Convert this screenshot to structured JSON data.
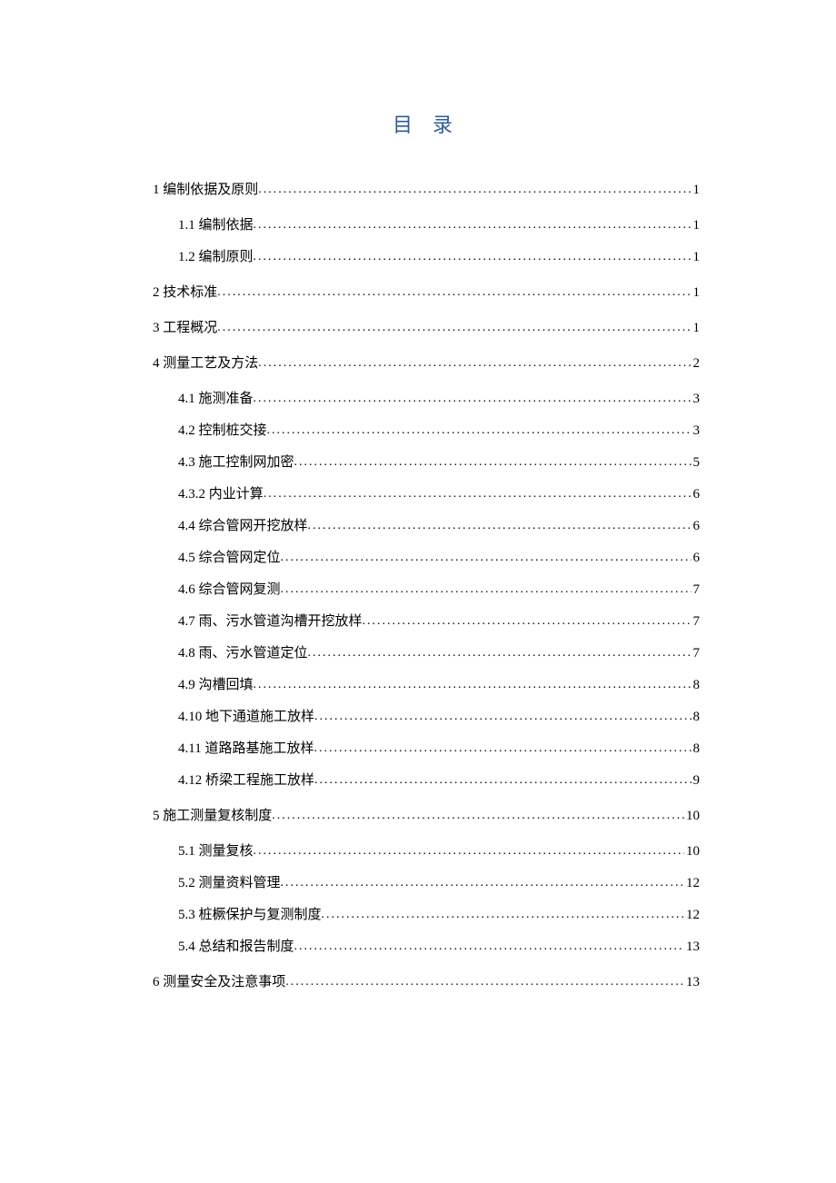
{
  "title": "目 录",
  "entries": [
    {
      "level": 1,
      "label": "1 编制依据及原则",
      "page": "1"
    },
    {
      "level": 2,
      "label": "1.1 编制依据 ",
      "page": "1"
    },
    {
      "level": 2,
      "label": "1.2 编制原则 ",
      "page": "1"
    },
    {
      "level": 1,
      "label": "2 技术标准",
      "page": "1"
    },
    {
      "level": 1,
      "label": "3 工程概况",
      "page": "1"
    },
    {
      "level": 1,
      "label": "4 测量工艺及方法 ",
      "page": "2"
    },
    {
      "level": 2,
      "label": "4.1 施测准备",
      "page": "3"
    },
    {
      "level": 2,
      "label": "4.2 控制桩交接",
      "page": "3"
    },
    {
      "level": 2,
      "label": "4.3  施工控制网加密 ",
      "page": "5"
    },
    {
      "level": 2,
      "label": "4.3.2 内业计算",
      "page": "6"
    },
    {
      "level": 2,
      "label": "4.4 综合管网开挖放样",
      "page": "6"
    },
    {
      "level": 2,
      "label": "4.5 综合管网定位",
      "page": "6"
    },
    {
      "level": 2,
      "label": "4.6 综合管网复测",
      "page": "7"
    },
    {
      "level": 2,
      "label": "4.7 雨、污水管道沟槽开挖放样",
      "page": "7"
    },
    {
      "level": 2,
      "label": "4.8 雨、污水管道定位",
      "page": "7"
    },
    {
      "level": 2,
      "label": "4.9 沟槽回填",
      "page": "8"
    },
    {
      "level": 2,
      "label": "4.10 地下通道施工放样",
      "page": "8"
    },
    {
      "level": 2,
      "label": "4.11 道路路基施工放样",
      "page": "8"
    },
    {
      "level": 2,
      "label": "4.12 桥梁工程施工放样",
      "page": "9"
    },
    {
      "level": 1,
      "label": "5 施工测量复核制度 ",
      "page": "10"
    },
    {
      "level": 2,
      "label": "5.1 测量复核",
      "page": "10"
    },
    {
      "level": 2,
      "label": "5.2 测量资料管理",
      "page": "12"
    },
    {
      "level": 2,
      "label": "5.3 桩橛保护与复测制度",
      "page": "12"
    },
    {
      "level": 2,
      "label": "5.4 总结和报告制度",
      "page": "13"
    },
    {
      "level": 1,
      "label": "6 测量安全及注意事项 ",
      "page": "13"
    }
  ]
}
